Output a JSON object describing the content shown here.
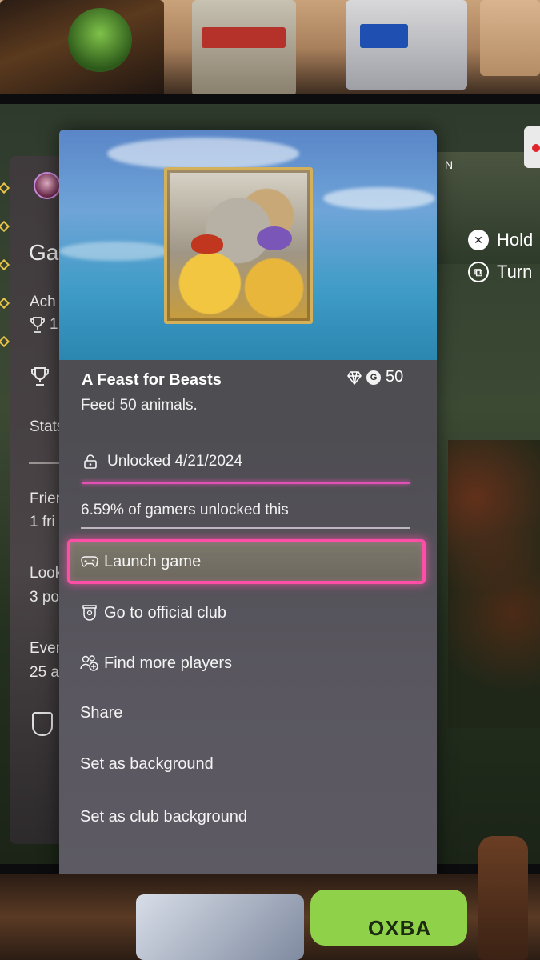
{
  "card": {
    "title": "A Feast for Beasts",
    "description": "Feed 50 animals.",
    "gamerscore": "50",
    "unlocked_text": "Unlocked 4/21/2024",
    "rarity_text": "6.59% of gamers unlocked this",
    "menu": [
      {
        "label": "Launch game",
        "icon": "controller-icon"
      },
      {
        "label": "Go to official club",
        "icon": "club-shield-icon"
      },
      {
        "label": "Find more players",
        "icon": "add-people-icon"
      },
      {
        "label": "Share"
      },
      {
        "label": "Set as background"
      },
      {
        "label": "Set as club background"
      }
    ]
  },
  "background_panel": {
    "title_partial": "Ga",
    "achievements_partial": "Ach",
    "achievements_count_partial": "1",
    "stats_partial": "Stats",
    "friends_partial": "Frien",
    "friends_count_partial": "1 fri",
    "looking_partial": "Look",
    "looking_count_partial": "3 po",
    "events_partial": "Even",
    "events_count_partial": "25 a"
  },
  "hints": {
    "hold": "Hold",
    "turn": "Turn",
    "compass": "N"
  },
  "photo": {
    "band_text": "OXBA"
  },
  "colors": {
    "focus_pink": "#ff4ea6",
    "card_bg": "#4d4d50"
  }
}
